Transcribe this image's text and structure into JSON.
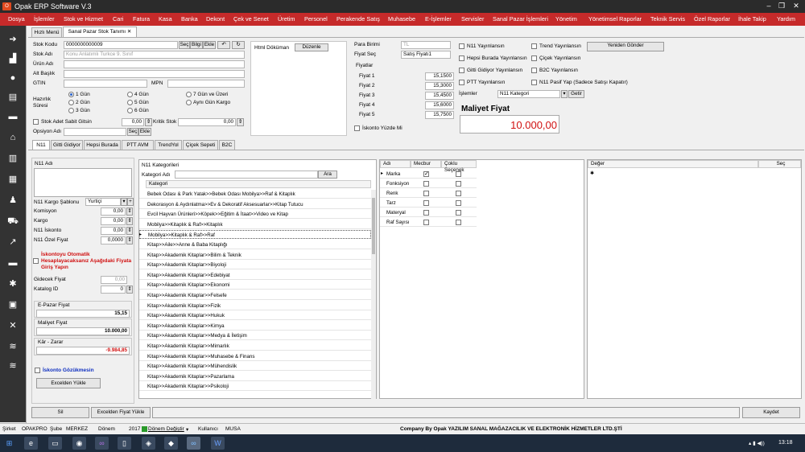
{
  "window": {
    "title": "Opak ERP Software V.3"
  },
  "menu": [
    "Dosya",
    "İşlemler",
    "Stok ve Hizmet",
    "Cari",
    "Fatura",
    "Kasa",
    "Banka",
    "Dekont",
    "Çek ve Senet",
    "Üretim",
    "Personel",
    "Perakende Satış",
    "Muhasebe",
    "E-İşlemler",
    "Servisler",
    "Sanal Pazar İşlemleri",
    "Yönetim",
    "Yönetimsel Raporlar",
    "Teknik Servis",
    "Özel Raporlar",
    "İhale Takip",
    "Yardım"
  ],
  "doc_tabs": {
    "menu": "Hızlı Menü",
    "active": "Sanal Pazar Stok Tanımı"
  },
  "stock": {
    "kod_label": "Stok Kodu",
    "kod_value": "0000000000009",
    "adi_label": "Stok Adı",
    "adi_value": "Konu Anlatımlı Turkce 9. Sınıf",
    "urun_label": "Ürün Adı",
    "alt_label": "Alt Başlık",
    "gtin_label": "GTIN",
    "mpn_label": "MPN",
    "sec": "Seç",
    "bilgi": "Bilgi",
    "ekle": "Ekle",
    "hazirlik_label": "Hazırlık Süresi",
    "gun1": "1 Gün",
    "gun2": "2 Gün",
    "gun3": "3 Gün",
    "gun4": "4 Gün",
    "gun5": "5 Gün",
    "gun6": "6 Gün",
    "gun7": "7 Gün ve Üzeri",
    "ayni": "Aynı Gün Kargo",
    "stok_adet": "Stok Adet Sabit Gitsin",
    "stok_adet_val": "0,00",
    "kritik": "Kritik Stok",
    "kritik_val": "0,00",
    "opsiyon": "Opsiyon Adı"
  },
  "html": {
    "label": "Html Döküman",
    "edit": "Düzenle"
  },
  "pricing": {
    "pb_label": "Para Birimi",
    "pb_value": "TL",
    "fs_label": "Fiyat Seç",
    "fs_value": "Satış Fiyatı1",
    "fiyatlar": "Fiyatlar",
    "prices": [
      {
        "label": "Fiyat 1",
        "value": "15,1500"
      },
      {
        "label": "Fiyat 2",
        "value": "15,3000"
      },
      {
        "label": "Fiyat 3",
        "value": "15,4500"
      },
      {
        "label": "Fiyat 4",
        "value": "15,6000"
      },
      {
        "label": "Fiyat 5",
        "value": "15,7500"
      }
    ],
    "iskonto": "İskonto Yüzde Mi"
  },
  "publish": {
    "n11": "N11 Yayınlansın",
    "trend": "Trend Yayınlansın",
    "resend": "Yeniden Gönder",
    "hb": "Hepsi Burada Yayınlansın",
    "cicek": "Çiçek Yayınlansın",
    "gg": "Gitti Gidiyor Yayınlansın",
    "b2c": "B2C Yayınlansın",
    "ptt": "PTT Yayınlansın",
    "n11pasif": "N11 Pasif Yap (Sadece Satışı Kapatır)",
    "islemler": "İşlemler",
    "islem_value": "N11 Kategori",
    "getir": "Getir"
  },
  "maliyet": {
    "label": "Maliyet Fiyat",
    "value": "10.000,00"
  },
  "market_tabs": [
    "N11",
    "Gitti Gidiyor",
    "Hepsi Burada",
    "PTT AVM",
    "TrendYol",
    "Çiçek Sepeti",
    "B2C"
  ],
  "n11": {
    "adi": "N11 Adı",
    "kargo_label": "N11 Kargo Şablonu",
    "kargo_value": "Yurtiçi",
    "fields": [
      {
        "label": "Komisyon",
        "value": "0,00"
      },
      {
        "label": "Kargo",
        "value": "0,00"
      },
      {
        "label": "N11 İskonto",
        "value": "0,00"
      },
      {
        "label": "N11 Özel Fiyat",
        "value": "0,0000"
      }
    ],
    "warn": "İskontoyu Otomatik Hesaplayacaksanız Aşağıdaki Fiyata Giriş Yapın",
    "gidecek": "Gidecek Fiyat",
    "gidecek_val": "0,00",
    "katalog": "Katalog ID",
    "katalog_val": "0",
    "epazar": "E-Pazar Fiyat",
    "epazar_val": "15,15",
    "mal": "Maliyet Fiyat",
    "mal_val": "10.000,00",
    "kar": "Kâr - Zarar",
    "kar_val": "-9.984,85",
    "isk_goz": "İskonto Gözükmesin",
    "excel": "Excelden Yükle"
  },
  "categories": {
    "title": "N11 Kategorileri",
    "search_label": "Kategori Adı",
    "search_btn": "Ara",
    "col": "Kategori",
    "items": [
      "Bebek Odası & Park Yatak>>Bebek Odası Mobilya>>Raf & Kitaplık",
      "Dekorasyon & Aydınlatma>>Ev & Dekoratif Aksesuarlar>>Kitap Tutucu",
      "Evcil Hayvan Ürünleri>>Köpek>>Eğitim & İtaat>>Video ve Kitap",
      "Mobilya>>Kitaplık & Raf>>Kitaplık",
      "Mobilya>>Kitaplık & Raf>>Raf",
      "Kitap>>Aile>>Anne & Baba Kitaplığı",
      "Kitap>>Akademik Kitaplar>>Bilim & Teknik",
      "Kitap>>Akademik Kitaplar>>Biyoloji",
      "Kitap>>Akademik Kitaplar>>Edebiyat",
      "Kitap>>Akademik Kitaplar>>Ekonomi",
      "Kitap>>Akademik Kitaplar>>Felsefe",
      "Kitap>>Akademik Kitaplar>>Fizik",
      "Kitap>>Akademik Kitaplar>>Hukuk",
      "Kitap>>Akademik Kitaplar>>Kimya",
      "Kitap>>Akademik Kitaplar>>Medya & İletişim",
      "Kitap>>Akademik Kitaplar>>Mimarlık",
      "Kitap>>Akademik Kitaplar>>Muhasebe & Finans",
      "Kitap>>Akademik Kitaplar>>Mühendislik",
      "Kitap>>Akademik Kitaplar>>Pazarlama",
      "Kitap>>Akademik Kitaplar>>Psikoloji"
    ]
  },
  "attrs": {
    "cols": [
      "Adı",
      "Mecbur",
      "Çoklu Seçenek"
    ],
    "rows": [
      "Marka",
      "Fonksiyon",
      "Renk",
      "Tarz",
      "Materyal",
      "Raf Sayısı"
    ]
  },
  "values": {
    "cols": [
      "Değer",
      "Seç"
    ]
  },
  "buttons": {
    "sil": "Sil",
    "excel_fiyat": "Excelden Fiyat Yükle",
    "kaydet": "Kaydet"
  },
  "status": {
    "sirket_l": "Şirket",
    "sirket": "OPAKPRO",
    "sube_l": "Şube",
    "sube": "MERKEZ",
    "donem_l": "Dönem",
    "donem": "2017",
    "donem_btn": "Dönem Değiştir",
    "kul_l": "Kullanıcı",
    "kul": "MUSA",
    "company": "Company By Opak YAZILIM SANAL MAĞAZACILIK VE ELEKTRONİK HİZMETLER LTD.ŞTİ"
  },
  "taskbar": {
    "time": "13:18"
  }
}
